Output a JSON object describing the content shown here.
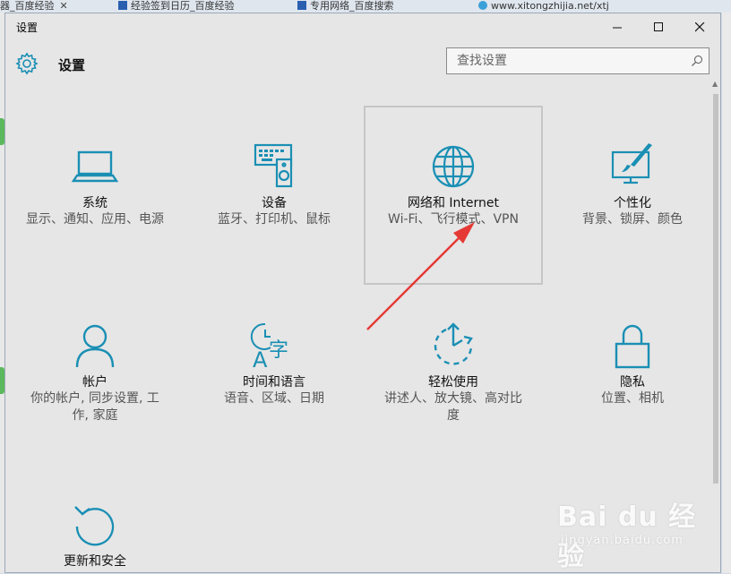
{
  "browser_tabs": [
    {
      "label": "器_百度经验"
    },
    {
      "label": "经验签到日历_百度经验"
    },
    {
      "label": "专用网络_百度搜索"
    },
    {
      "label": "www.xitongzhijia.net/xtj"
    }
  ],
  "window": {
    "title": "设置",
    "minimize_icon": "minimize-icon",
    "maximize_icon": "maximize-icon",
    "close_icon": "close-icon"
  },
  "header": {
    "icon": "gear-icon",
    "title": "设置"
  },
  "search": {
    "placeholder": "查找设置",
    "icon": "search-icon"
  },
  "accent_color": "#1a8fb4",
  "tiles": [
    {
      "name": "系统",
      "desc": "显示、通知、应用、电源",
      "icon": "laptop-icon"
    },
    {
      "name": "设备",
      "desc": "蓝牙、打印机、鼠标",
      "icon": "devices-icon"
    },
    {
      "name": "网络和 Internet",
      "desc": "Wi-Fi、飞行模式、VPN",
      "icon": "globe-icon",
      "selected": true
    },
    {
      "name": "个性化",
      "desc": "背景、锁屏、颜色",
      "icon": "personalization-icon"
    },
    {
      "name": "帐户",
      "desc": "你的帐户, 同步设置, 工作, 家庭",
      "icon": "person-icon"
    },
    {
      "name": "时间和语言",
      "desc": "语音、区域、日期",
      "icon": "time-language-icon"
    },
    {
      "name": "轻松使用",
      "desc": "讲述人、放大镜、高对比度",
      "icon": "ease-of-access-icon"
    },
    {
      "name": "隐私",
      "desc": "位置、相机",
      "icon": "lock-icon"
    },
    {
      "name": "更新和安全",
      "desc": "",
      "icon": "update-icon"
    }
  ],
  "annotation_color": "#e53935",
  "watermark": {
    "logo": "Bai du 经验",
    "site": "jingyan.baidu.com"
  }
}
